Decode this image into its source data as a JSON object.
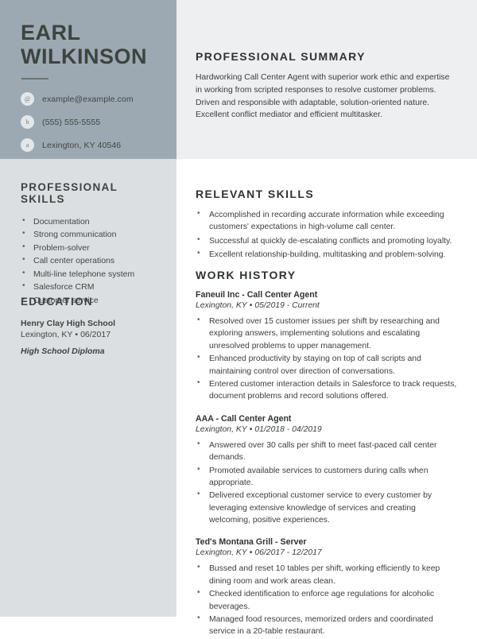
{
  "header": {
    "first_name": "EARL",
    "last_name": "WILKINSON",
    "contacts": [
      {
        "icon": "email-icon",
        "glyph": "@",
        "text": "example@example.com"
      },
      {
        "icon": "home-phone-icon",
        "glyph": "h",
        "text": "(555) 555-5555"
      },
      {
        "icon": "address-icon",
        "glyph": "a",
        "text": "Lexington, KY 40546"
      }
    ]
  },
  "sidebar": {
    "professional_skills": {
      "heading": "PROFESSIONAL SKILLS",
      "items": [
        "Documentation",
        "Strong communication",
        "Problem-solver",
        "Call center operations",
        "Multi-line telephone system",
        "Salesforce CRM",
        "Customer service"
      ]
    },
    "education": {
      "heading": "EDUCATION",
      "school": "Henry Clay High School",
      "location": "Lexington, KY",
      "separator": "•",
      "date": "06/2017",
      "degree": "High School Diploma"
    }
  },
  "main": {
    "summary": {
      "heading": "PROFESSIONAL SUMMARY",
      "text": "Hardworking Call Center Agent with superior work ethic and expertise in working from scripted responses to resolve customer problems. Driven and responsible with adaptable, solution-oriented nature. Excellent conflict mediator and efficient multitasker."
    },
    "relevant_skills": {
      "heading": "RELEVANT SKILLS",
      "items": [
        "Accomplished in recording accurate information while exceeding customers' expectations in high-volume call center.",
        "Successful at quickly de-escalating conflicts and promoting loyalty.",
        "Excellent relationship-building, multitasking and problem-solving."
      ]
    },
    "work_history": {
      "heading": "WORK HISTORY",
      "jobs": [
        {
          "title": "Faneuil Inc - Call Center Agent",
          "location": "Lexington, KY",
          "separator": "•",
          "dates": "05/2019 - Current",
          "bullets": [
            "Resolved over 15 customer issues per shift by researching and exploring answers, implementing solutions and escalating unresolved problems to upper management.",
            "Enhanced productivity by staying on top of call scripts and maintaining control over direction of conversations.",
            "Entered customer interaction details in Salesforce to track requests, document problems and record solutions offered."
          ]
        },
        {
          "title": "AAA - Call Center Agent",
          "location": "Lexington, KY",
          "separator": "•",
          "dates": "01/2018 - 04/2019",
          "bullets": [
            "Answered over 30 calls per shift to meet fast-paced call center demands.",
            "Promoted available services to customers during calls when appropriate.",
            "Delivered exceptional customer service to every customer by leveraging extensive knowledge of services and creating welcoming, positive experiences."
          ]
        },
        {
          "title": "Ted's Montana Grill - Server",
          "location": "Lexington, KY",
          "separator": "•",
          "dates": "06/2017 - 12/2017",
          "bullets": [
            "Bussed and reset 10 tables per shift, working efficiently to keep dining room and work areas clean.",
            "Checked identification to enforce age regulations for alcoholic beverages.",
            "Managed food resources, memorized orders and coordinated service in a 20-table restaurant."
          ]
        }
      ]
    }
  },
  "colors": {
    "header_block": "#9da9b2",
    "sidebar": "#dcdfe2",
    "summary_block": "#eeeff1",
    "text_dark": "#3d4440",
    "text_body": "#3a3f3c"
  }
}
